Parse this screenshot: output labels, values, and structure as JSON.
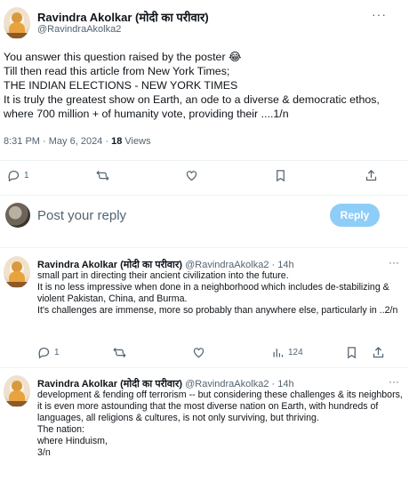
{
  "main_tweet": {
    "author_name": "Ravindra Akolkar (मोदी का परीवार)",
    "author_handle": "@RavindraAkolka2",
    "more_label": "···",
    "body": "You answer this question raised by the poster 😂\nTill then read this article from New York Times;\nTHE INDIAN ELECTIONS - NEW YORK TIMES\n It is truly the greatest show on Earth, an ode to a diverse & democratic ethos, where 700  million + of humanity vote, providing their ....1/n",
    "time": "8:31 PM",
    "separator": "·",
    "date": "May 6, 2024",
    "views_count": "18",
    "views_label": "Views",
    "actions": {
      "reply_count": "1",
      "icons": [
        "reply-icon",
        "retweet-icon",
        "like-icon",
        "bookmark-icon",
        "share-icon"
      ]
    }
  },
  "reply_composer": {
    "placeholder": "Post your reply",
    "button_label": "Reply"
  },
  "replies": [
    {
      "author_name": "Ravindra Akolkar (मोदी का परीवार)",
      "author_handle": "@RavindraAkolka2",
      "dot": "·",
      "time": "14h",
      "more_label": "···",
      "text": "small part in directing their ancient civilization into the future.\nIt is no less impressive when done in a neighborhood which includes de-stabilizing & violent Pakistan, China, and Burma.\nIt's challenges are immense, more so probably  than anywhere else, particularly in  ..2/n",
      "reply_count": "1",
      "views_count": "124"
    },
    {
      "author_name": "Ravindra Akolkar (मोदी का परीवार)",
      "author_handle": "@RavindraAkolka2",
      "dot": "·",
      "time": "14h",
      "more_label": "···",
      "text": "development & fending off terrorism -- but considering these challenges & its neighbors, it is even more astounding that the most diverse nation on Earth, with hundreds of languages, all religions & cultures, is not only surviving, but thriving.\nThe nation:\nwhere Hinduism,\n3/n"
    }
  ],
  "colors": {
    "text": "#0f1419",
    "secondary": "#536471",
    "divider": "#eff3f4",
    "reply_button": "#8ecdf8"
  }
}
